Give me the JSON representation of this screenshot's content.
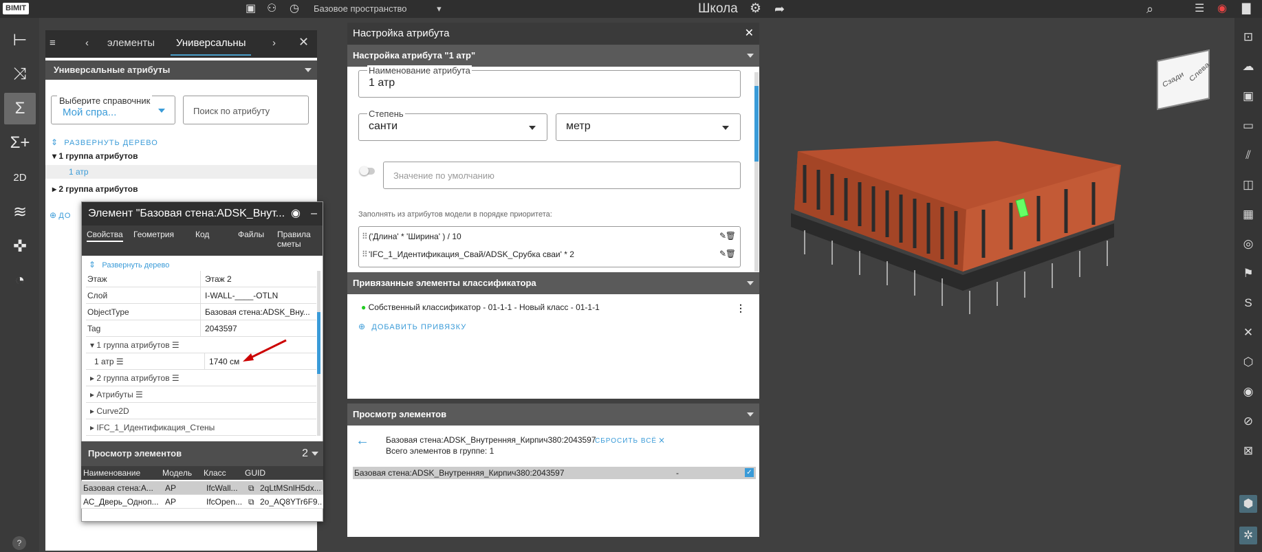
{
  "app": {
    "logo": "BIMIT",
    "space": "Базовое пространство",
    "project": "Школа"
  },
  "left_panel": {
    "tab_prev": "элементы",
    "tab_active": "Универсальны",
    "section_title": "Универсальные атрибуты",
    "directory_label": "Выберите справочник",
    "directory_value": "Мой спра...",
    "search_placeholder": "Поиск по атрибуту",
    "expand_tree": "РАЗВЕРНУТЬ ДЕРЕВО",
    "tree": [
      {
        "label": "1 группа атрибутов",
        "bold": true
      },
      {
        "label": "1 атр",
        "bold": false
      },
      {
        "label": "2 группа атрибутов",
        "bold": true
      }
    ],
    "add_label": "ДО"
  },
  "element_panel": {
    "title": "Элемент \"Базовая стена:ADSK_Внут...",
    "tabs": [
      "Свойства",
      "Геометрия",
      "Код",
      "Файлы",
      "Правила сметы"
    ],
    "expand_tree": "Развернуть дерево",
    "properties": [
      {
        "key": "Этаж",
        "value": "Этаж 2"
      },
      {
        "key": "Слой",
        "value": "I-WALL-____-OTLN"
      },
      {
        "key": "ObjectType",
        "value": "Базовая стена:ADSK_Вну..."
      },
      {
        "key": "Tag",
        "value": "2043597"
      }
    ],
    "groups": [
      {
        "label": "1 группа атрибутов",
        "expanded": true
      },
      {
        "label": "1 атр",
        "value": "1740 см"
      },
      {
        "label": "2 группа атрибутов",
        "expanded": false
      },
      {
        "label": "Атрибуты",
        "expanded": false
      },
      {
        "label": "Curve2D",
        "expanded": false
      },
      {
        "label": "IFC_1_Идентификация_Стены",
        "expanded": false
      }
    ],
    "viewer_title": "Просмотр элементов",
    "viewer_count": "2",
    "columns": [
      "Наименование",
      "Модель",
      "Класс",
      "GUID"
    ],
    "rows": [
      [
        "Базовая стена:А...",
        "АР",
        "IfcWall...",
        "2qLtMSnlH5dx..."
      ],
      [
        "АС_Дверь_Одноп...",
        "АР",
        "IfcOpen...",
        "2o_AQ8YTr6F9..."
      ]
    ]
  },
  "attr_dialog": {
    "title": "Настройка атрибута",
    "subtitle": "Настройка атрибута \"1 атр\"",
    "name_label": "Наименование атрибута",
    "name_value": "1 атр",
    "degree_label": "Степень",
    "degree_value": "санти",
    "unit_value": "метр",
    "default_placeholder": "Значение по умолчанию",
    "priority_label": "Заполнять из атрибутов модели в порядке приоритета:",
    "formulas": [
      "('Длина' * 'Ширина' ) / 10",
      "'IFC_1_Идентификация_Свай/ADSK_Срубка сваи' * 2"
    ],
    "classifier_title": "Привязанные элементы классификатора",
    "classifier_item": "Собственный классификатор - 01-1-1 - Новый класс - 01-1-1",
    "add_binding": "ДОБАВИТЬ ПРИВЯЗКУ",
    "view_title": "Просмотр элементов",
    "view_element": "Базовая стена:ADSK_Внутренняя_Кирпич380:2043597",
    "reset_all": "СБРОСИТЬ ВСЁ",
    "group_count": "Всего элементов в группе: 1",
    "list_row": "Базовая стена:ADSK_Внутренняя_Кирпич380:2043597",
    "list_row_value": "-"
  },
  "viewcube": {
    "front": "Сзади",
    "right": "Слева"
  },
  "colors": {
    "accent": "#3a9bd8",
    "brick": "#b8502f",
    "dark": "#2f2f2f"
  }
}
